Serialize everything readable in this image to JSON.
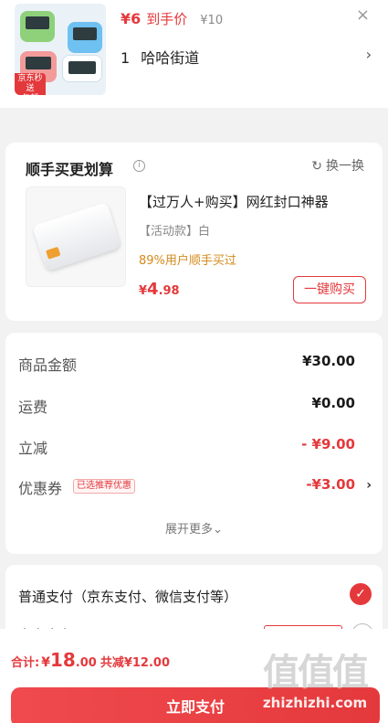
{
  "header": {
    "product_badge": "京东秒送\n包邮",
    "price": "¥6",
    "price_label": "到手价",
    "original_price": "¥10",
    "close_symbol": "×",
    "quantity": "1",
    "store_name": "哈哈街道",
    "chevron": "›"
  },
  "combo": {
    "title": "顺手买更划算",
    "info_symbol": "i",
    "refresh_label": "换一换",
    "refresh_symbol": "↻",
    "product_name": "【过万人+购买】网红封口神器",
    "spec": "【活动款】白",
    "rate": "89%用户顺手买过",
    "price_currency": "¥",
    "price_int": "4",
    "price_dec": ".98",
    "buy_label": "一键购买"
  },
  "amounts": {
    "rows": [
      {
        "label": "商品金额",
        "value": "¥30.00"
      },
      {
        "label": "运费",
        "value": "¥0.00"
      },
      {
        "label": "立减",
        "value": "- ¥9.00"
      },
      {
        "label": "优惠券",
        "tag": "已选推荐优惠",
        "value": "-¥3.00",
        "chevron": "›"
      }
    ],
    "more_label": "展开更多⌄"
  },
  "payment": {
    "method_label": "普通支付（京东支付、微信支付等）",
    "check_symbol": "✓",
    "method2_label": "京东白条"
  },
  "bottom": {
    "total_label": "合计:",
    "total_currency": "¥",
    "total_int": "18",
    "total_dec": ".00",
    "save_label": "共减¥12.00",
    "submit_label": "立即支付"
  },
  "watermark": {
    "big": "值值值",
    "small": "zhizhizhi.com"
  },
  "colors": {
    "accent": "#e4393c",
    "rate": "#d48a1c"
  }
}
